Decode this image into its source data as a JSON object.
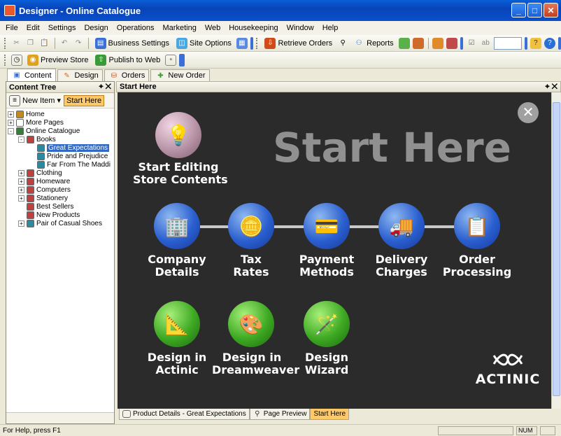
{
  "window": {
    "title": "Designer - Online Catalogue",
    "minimize": "_",
    "maximize": "□",
    "close": "✕"
  },
  "menu": [
    "File",
    "Edit",
    "Settings",
    "Design",
    "Operations",
    "Marketing",
    "Web",
    "Housekeeping",
    "Window",
    "Help"
  ],
  "toolbar1": {
    "business_settings": "Business Settings",
    "site_options": "Site Options",
    "retrieve_orders": "Retrieve Orders",
    "reports": "Reports"
  },
  "toolbar2": {
    "preview_store": "Preview Store",
    "publish_to_web": "Publish to Web"
  },
  "tabs": [
    "Content",
    "Design",
    "Orders",
    "New Order"
  ],
  "content_tree": {
    "title": "Content Tree",
    "pin": "⌖ ✕",
    "new_item": "New Item",
    "start_here": "Start Here",
    "items": [
      {
        "label": "Home",
        "level": 0,
        "expander": "+",
        "color": "#c08a20"
      },
      {
        "label": "More Pages",
        "level": 0,
        "expander": "+",
        "color": "#ffffff"
      },
      {
        "label": "Online Catalogue",
        "level": 0,
        "expander": "-",
        "color": "#3a7a3a"
      },
      {
        "label": "Books",
        "level": 1,
        "expander": "-",
        "color": "#c04040"
      },
      {
        "label": "Great Expectations",
        "level": 2,
        "expander": "",
        "color": "#2a8aa0",
        "selected": true
      },
      {
        "label": "Pride and Prejudice",
        "level": 2,
        "expander": "",
        "color": "#2a8aa0"
      },
      {
        "label": "Far From The Maddi",
        "level": 2,
        "expander": "",
        "color": "#2a8aa0"
      },
      {
        "label": "Clothing",
        "level": 1,
        "expander": "+",
        "color": "#c04040"
      },
      {
        "label": "Homeware",
        "level": 1,
        "expander": "+",
        "color": "#c04040"
      },
      {
        "label": "Computers",
        "level": 1,
        "expander": "+",
        "color": "#c04040"
      },
      {
        "label": "Stationery",
        "level": 1,
        "expander": "+",
        "color": "#c04040"
      },
      {
        "label": "Best Sellers",
        "level": 1,
        "expander": "",
        "color": "#c04040"
      },
      {
        "label": "New Products",
        "level": 1,
        "expander": "",
        "color": "#c04040"
      },
      {
        "label": "Pair of Casual Shoes",
        "level": 1,
        "expander": "+",
        "color": "#2a8aa0"
      }
    ]
  },
  "main": {
    "header": "Start Here",
    "header_controls": "⌖ ✕",
    "title": "Start Here",
    "close": "✕",
    "start_editing": [
      "Start Editing",
      "Store Contents"
    ],
    "steps": [
      {
        "line1": "Company",
        "line2": "Details",
        "icon": "🏢"
      },
      {
        "line1": "Tax",
        "line2": "Rates",
        "icon": "🪙"
      },
      {
        "line1": "Payment",
        "line2": "Methods",
        "icon": "💳"
      },
      {
        "line1": "Delivery",
        "line2": "Charges",
        "icon": "🚚"
      },
      {
        "line1": "Order",
        "line2": "Processing",
        "icon": "📋"
      }
    ],
    "design": [
      {
        "line1": "Design in",
        "line2": "Actinic",
        "icon": "📐"
      },
      {
        "line1": "Design in",
        "line2": "Dreamweaver",
        "icon": "🎨"
      },
      {
        "line1": "Design",
        "line2": "Wizard",
        "icon": "🪄"
      }
    ],
    "logo": "ACTINIC"
  },
  "doc_tabs": [
    "Product Details - Great Expectations",
    "Page Preview",
    "Start Here"
  ],
  "status": {
    "help": "For Help, press F1",
    "num": "NUM"
  }
}
